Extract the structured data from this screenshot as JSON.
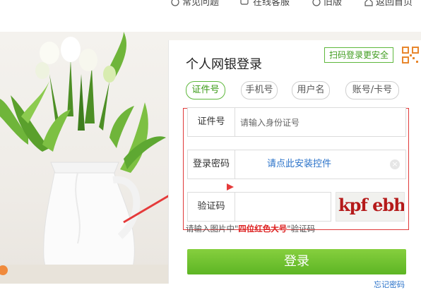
{
  "top_nav": {
    "items": [
      {
        "label": "常见问题",
        "icon": "question-icon"
      },
      {
        "label": "在线客服",
        "icon": "chat-icon"
      },
      {
        "label": "旧版",
        "icon": "clock-icon"
      },
      {
        "label": "返回首页",
        "icon": "home-icon"
      }
    ]
  },
  "login": {
    "title": "个人网银登录",
    "qr_login_label": "扫码登录更安全",
    "tabs": [
      "证件号",
      "手机号",
      "用户名",
      "账号/卡号"
    ],
    "active_tab": 0,
    "id_field": {
      "label": "证件号",
      "placeholder": "请输入身份证号"
    },
    "password_field": {
      "label": "登录密码",
      "install_link": "请点此安装控件"
    },
    "captcha_field": {
      "label": "验证码",
      "image_text": "kpf ebh"
    },
    "hint": {
      "prefix": "请输入图片中\"",
      "emphasis": "四位红色大号",
      "suffix": "\"验证码"
    },
    "submit_label": "登录",
    "forgot_label": "忘记密码"
  },
  "colors": {
    "accent_green": "#5fb83d",
    "button_green": "#6cc02e",
    "link_blue": "#2a72c9",
    "annotation_red": "#e03a3a"
  }
}
